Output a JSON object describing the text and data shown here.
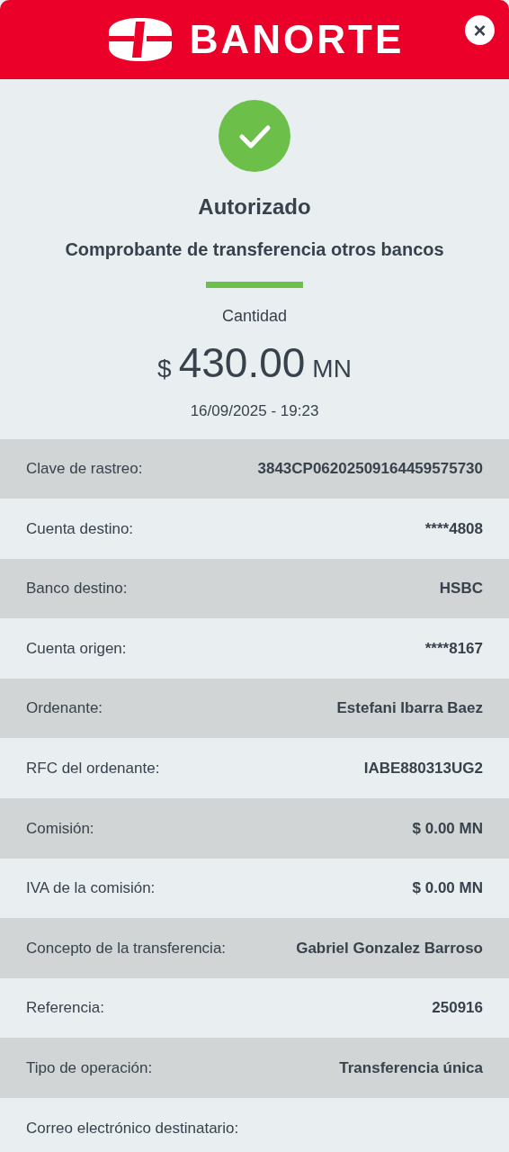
{
  "header": {
    "brand": "BANORTE",
    "close": "×"
  },
  "status": {
    "title": "Autorizado",
    "subtitle": "Comprobante de transferencia otros bancos"
  },
  "amount": {
    "label": "Cantidad",
    "currency": "$",
    "value": "430.00",
    "unit": "MN",
    "datetime": "16/09/2025 - 19:23"
  },
  "details": [
    {
      "label": "Clave de rastreo:",
      "value": "3843CP06202509164459575730"
    },
    {
      "label": "Cuenta destino:",
      "value": "****4808"
    },
    {
      "label": "Banco destino:",
      "value": "HSBC"
    },
    {
      "label": "Cuenta origen:",
      "value": "****8167"
    },
    {
      "label": "Ordenante:",
      "value": "Estefani Ibarra Baez"
    },
    {
      "label": "RFC del ordenante:",
      "value": "IABE880313UG2"
    },
    {
      "label": "Comisión:",
      "value": "$ 0.00 MN"
    },
    {
      "label": "IVA de la comisión:",
      "value": "$ 0.00 MN"
    },
    {
      "label": "Concepto de la transferencia:",
      "value": "Gabriel Gonzalez Barroso"
    },
    {
      "label": "Referencia:",
      "value": "250916"
    },
    {
      "label": "Tipo de operación:",
      "value": "Transferencia única"
    },
    {
      "label": "Correo electrónico destinatario:"
    }
  ]
}
